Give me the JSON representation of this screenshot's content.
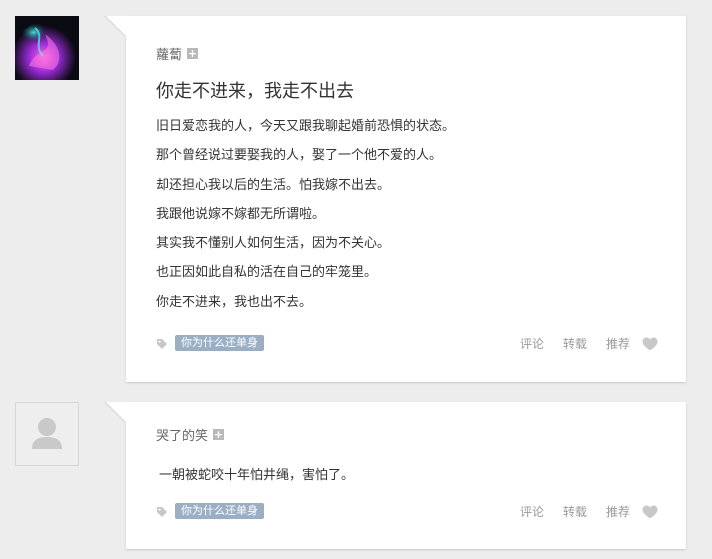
{
  "posts": [
    {
      "author": "蘿蔔",
      "follow_icon": "+",
      "title": "你走不进来，我走不出去",
      "body": [
        "旧日爱恋我的人，今天又跟我聊起婚前恐惧的状态。",
        "那个曾经说过要娶我的人，娶了一个他不爱的人。",
        "却还担心我以后的生活。怕我嫁不出去。",
        "我跟他说嫁不嫁都无所谓啦。",
        "其实我不懂别人如何生活，因为不关心。",
        "也正因如此自私的活在自己的牢笼里。",
        "你走不进来，我也出不去。"
      ],
      "tag": "你为什么还单身",
      "actions": {
        "comment": "评论",
        "repost": "转载",
        "recommend": "推荐"
      }
    },
    {
      "author": "哭了的笑",
      "follow_icon": "+",
      "quote": "一朝被蛇咬十年怕井绳，害怕了。",
      "tag": "你为什么还单身",
      "actions": {
        "comment": "评论",
        "repost": "转载",
        "recommend": "推荐"
      }
    }
  ],
  "icons": {
    "tag": "tag-icon",
    "like": "heart-icon",
    "follow": "plus-icon",
    "default_avatar": "person-icon"
  },
  "colors": {
    "background": "#ededed",
    "card": "#ffffff",
    "tag_chip": "#9aaec4",
    "muted_text": "#999999",
    "heart": "#c8c8c8"
  }
}
